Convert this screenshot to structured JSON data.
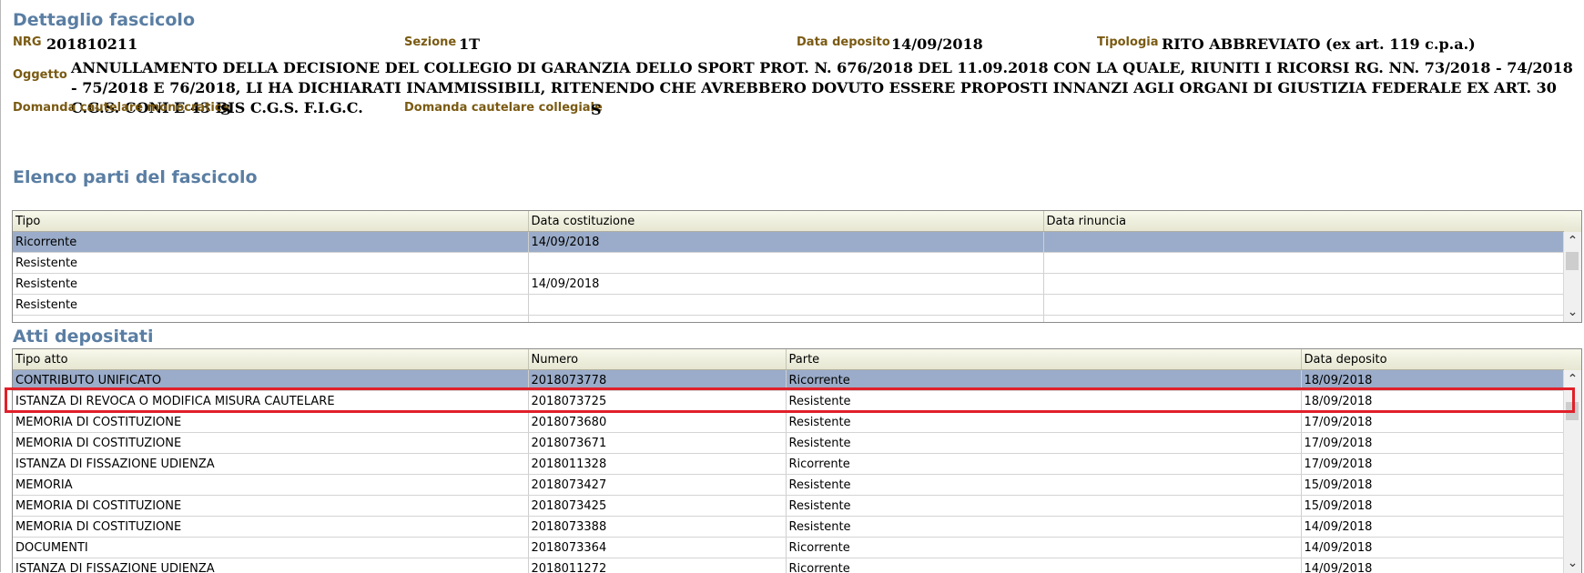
{
  "details": {
    "title": "Dettaglio fascicolo",
    "nrg_label": "NRG",
    "nrg_value": "201810211",
    "sezione_label": "Sezione",
    "sezione_value": "1T",
    "data_deposito_label": "Data deposito",
    "data_deposito_value": "14/09/2018",
    "tipologia_label": "Tipologia",
    "tipologia_value": "RITO ABBREVIATO (ex art. 119 c.p.a.)",
    "oggetto_label": "Oggetto",
    "oggetto_value": "ANNULLAMENTO DELLA DECISIONE DEL COLLEGIO DI GARANZIA DELLO SPORT PROT. N. 676/2018 DEL 11.09.2018 CON LA QUALE, RIUNITI I RICORSI RG. NN. 73/2018 - 74/2018 - 75/2018 E 76/2018, LI HA DICHIARATI INAMMISSIBILI, RITENENDO CHE AVREBBERO DOVUTO ESSERE PROPOSTI INNANZI AGLI ORGANI DI GIUSTIZIA FEDERALE EX ART. 30 C.G.S. CONI E 43 BIS C.G.S. F.I.G.C.",
    "monocratica_label": "Domanda cautelare monocratica",
    "monocratica_value": "S",
    "collegiale_label": "Domanda cautelare collegiale",
    "collegiale_value": "S"
  },
  "parti": {
    "title": "Elenco parti del fascicolo",
    "headers": [
      "Tipo",
      "Data costituzione",
      "Data rinuncia"
    ],
    "rows": [
      [
        "Ricorrente",
        "14/09/2018",
        ""
      ],
      [
        "Resistente",
        "",
        ""
      ],
      [
        "Resistente",
        "14/09/2018",
        ""
      ],
      [
        "Resistente",
        "",
        ""
      ],
      [
        "",
        "",
        ""
      ]
    ]
  },
  "atti": {
    "title": "Atti depositati",
    "headers": [
      "Tipo atto",
      "Numero",
      "Parte",
      "Data deposito"
    ],
    "rows": [
      [
        "CONTRIBUTO UNIFICATO",
        "2018073778",
        "Ricorrente",
        "18/09/2018"
      ],
      [
        "ISTANZA DI REVOCA O MODIFICA MISURA CAUTELARE",
        "2018073725",
        "Resistente",
        "18/09/2018"
      ],
      [
        "MEMORIA DI COSTITUZIONE",
        "2018073680",
        "Resistente",
        "17/09/2018"
      ],
      [
        "MEMORIA DI COSTITUZIONE",
        "2018073671",
        "Resistente",
        "17/09/2018"
      ],
      [
        "ISTANZA DI FISSAZIONE UDIENZA",
        "2018011328",
        "Ricorrente",
        "17/09/2018"
      ],
      [
        "MEMORIA",
        "2018073427",
        "Resistente",
        "15/09/2018"
      ],
      [
        "MEMORIA DI COSTITUZIONE",
        "2018073425",
        "Resistente",
        "15/09/2018"
      ],
      [
        "MEMORIA DI COSTITUZIONE",
        "2018073388",
        "Resistente",
        "14/09/2018"
      ],
      [
        "DOCUMENTI",
        "2018073364",
        "Ricorrente",
        "14/09/2018"
      ],
      [
        "ISTANZA DI FISSAZIONE UDIENZA",
        "2018011272",
        "Ricorrente",
        "14/09/2018"
      ]
    ]
  },
  "icons": {
    "scroll_up": "chevron-up-icon",
    "scroll_down": "chevron-down-icon"
  },
  "colors": {
    "section_title": "#5a7ea3",
    "field_label": "#7a5a12",
    "selected_row": "#9aacc9",
    "highlight_box": "#e0202a"
  }
}
